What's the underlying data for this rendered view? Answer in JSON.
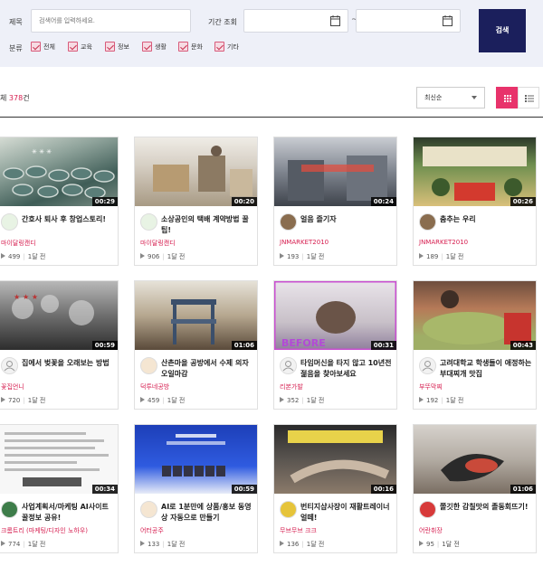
{
  "filters": {
    "title_label": "제목",
    "title_placeholder": "검색어를 입력하세요.",
    "period_label": "기간 조회",
    "tilde": "~",
    "search_button": "검색",
    "category_label": "분류",
    "categories": [
      "전체",
      "교육",
      "정보",
      "생활",
      "문화",
      "기타"
    ]
  },
  "list": {
    "total_prefix": "체",
    "total_count": "378",
    "total_suffix": "건",
    "sort_selected": "최신순"
  },
  "cards": [
    {
      "title": "간호사 퇴사 후 창업스토리!",
      "author": "마이달링캔디",
      "views": "499",
      "time": "1달 전",
      "duration": "00:29"
    },
    {
      "title": "소상공인의 택배 계약방법 꿀팁!",
      "author": "마이달링캔디",
      "views": "906",
      "time": "1달 전",
      "duration": "00:20"
    },
    {
      "title": "얼음 즐기자",
      "author": "JNMARKET2010",
      "views": "193",
      "time": "1달 전",
      "duration": "00:24"
    },
    {
      "title": "춤추는 우리",
      "author": "JNMARKET2010",
      "views": "189",
      "time": "1달 전",
      "duration": "00:26"
    },
    {
      "title": "집에서 벚꽃을 오래보는 방법",
      "author": "꽃집언니",
      "views": "720",
      "time": "1달 전",
      "duration": "00:59"
    },
    {
      "title": "산촌마을 공방에서 수제 의자 오일마감",
      "author": "덕투네공방",
      "views": "459",
      "time": "1달 전",
      "duration": "01:06"
    },
    {
      "title": "타임머신을 타지 않고 10년전 젊음을 찾아보세요",
      "author": "리본가발",
      "views": "352",
      "time": "1달 전",
      "duration": "00:31"
    },
    {
      "title": "고려대학교 학생들이 애정하는 부대찌개 맛집",
      "author": "부뚜막찌",
      "views": "192",
      "time": "1달 전",
      "duration": "00:43"
    },
    {
      "title": "사업계획서/마케팅 AI사이트 꿀정보 공유!",
      "author": "크롬트리 (마케팅/디자인 노하우)",
      "views": "774",
      "time": "1달 전",
      "duration": "00:34"
    },
    {
      "title": "AI로 1분만에 상품/홍보 동영상 자동으로 만들기",
      "author": "어터공주",
      "views": "133",
      "time": "1달 전",
      "duration": "00:59"
    },
    {
      "title": "번티지샵사장이 재활트레이너얼떼!",
      "author": "무브무브 크크",
      "views": "136",
      "time": "1달 전",
      "duration": "00:16"
    },
    {
      "title": "쫄깃한 감칠맛의 졸동회뜨기!",
      "author": "어란취장",
      "views": "95",
      "time": "1달 전",
      "duration": "01:06"
    }
  ]
}
